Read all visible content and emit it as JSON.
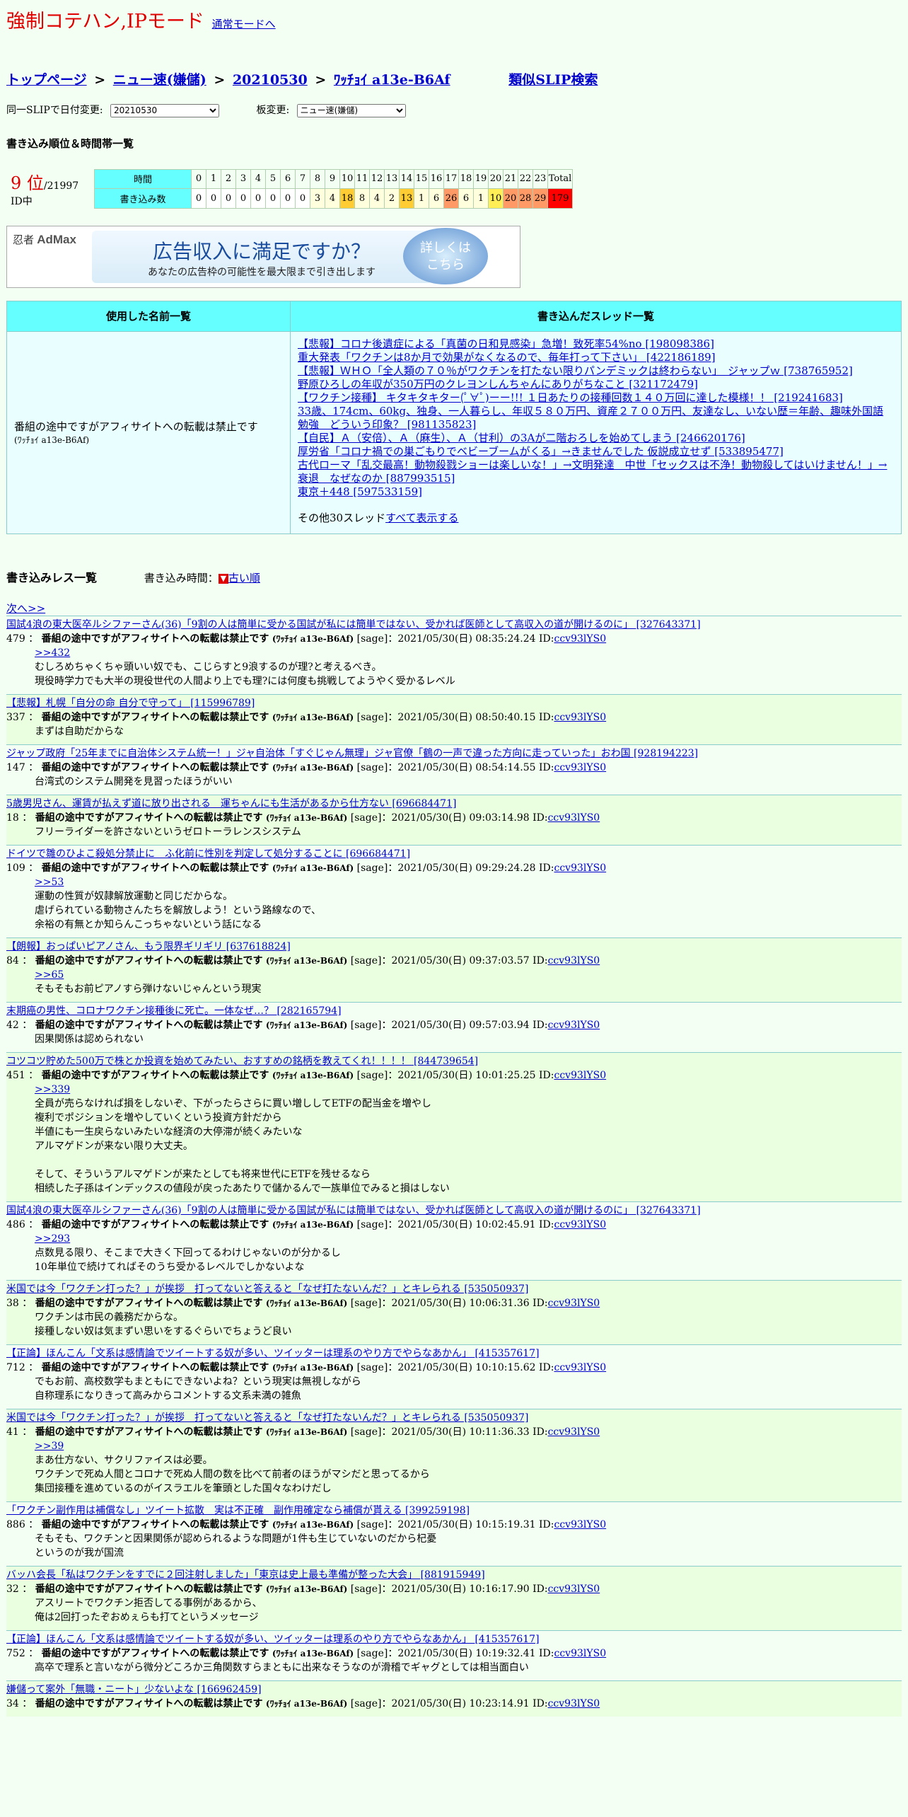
{
  "header": {
    "title": "強制コテハン,IPモード",
    "mode_link": "通常モードへ"
  },
  "breadcrumb": {
    "top": "トップページ",
    "board": "ニュー速(嫌儲)",
    "date": "20210530",
    "slip": "ﾜｯﾁｮｲ a13e-B6Af",
    "similar": "類似SLIP検索",
    "sep": ">"
  },
  "selectors": {
    "date_label": "同一SLIPで日付変更:",
    "date_value": "20210530",
    "board_label": "板変更:",
    "board_value": "ニュー速(嫌儲)"
  },
  "ranking": {
    "heading": "書き込み順位＆時間帯一覧",
    "rank": "9 位",
    "total_ids": "/21997 ID中",
    "time_label": "時間",
    "count_label": "書き込み数",
    "hours": [
      "0",
      "1",
      "2",
      "3",
      "4",
      "5",
      "6",
      "7",
      "8",
      "9",
      "10",
      "11",
      "12",
      "13",
      "14",
      "15",
      "16",
      "17",
      "18",
      "19",
      "20",
      "21",
      "22",
      "23",
      "Total"
    ],
    "counts": [
      "0",
      "0",
      "0",
      "0",
      "0",
      "0",
      "0",
      "0",
      "3",
      "4",
      "18",
      "8",
      "4",
      "2",
      "13",
      "1",
      "6",
      "26",
      "6",
      "1",
      "10",
      "20",
      "28",
      "29",
      "179"
    ],
    "colors": [
      "#ffffff",
      "#ffffff",
      "#ffffff",
      "#ffffff",
      "#ffffff",
      "#ffffff",
      "#ffffff",
      "#ffffff",
      "#ffffdd",
      "#ffffdd",
      "#ffcc33",
      "#ffffdd",
      "#ffffdd",
      "#ffffdd",
      "#ffcc33",
      "#ffffdd",
      "#ffffdd",
      "#ff9966",
      "#ffffdd",
      "#ffffdd",
      "#ffee55",
      "#ff9966",
      "#ff9966",
      "#ff9966",
      "#ff0000"
    ]
  },
  "ad": {
    "logo_a": "忍者",
    "logo_b": "AdMax",
    "headline": "広告収入に満足ですか？",
    "sub": "あなたの広告枠の可能性を最大限まで引き出します",
    "button_a": "詳しくは",
    "button_b": "こちら"
  },
  "names_table": {
    "col1": "使用した名前一覧",
    "col2": "書き込んだスレッド一覧",
    "name": "番組の途中ですがアフィサイトへの転載は禁止です",
    "name_sub": "(ﾜｯﾁｮｲ a13e-B6Af)",
    "threads": [
      "【悲報】コロナ後遺症による「真菌の日和見感染」急増！致死率54%no [198098386]",
      "重大発表「ワクチンは8か月で効果がなくなるので、毎年打って下さい」 [422186189]",
      "【悲報】ＷＨＯ「全人類の７０％がワクチンを打たない限りパンデミックは終わらない」　ジャップｗ [738765952]",
      "野原ひろしの年収が350万円のクレヨンしんちゃんにありがちなこと [321172479]",
      "【ワクチン接種】 キタキタキター(ﾟ∀ﾟ)ーー!!! １日あたりの接種回数１４０万回に達した模様！！ [219241683]",
      "33歳、174cm、60kg、独身、一人暮らし、年収５８０万円、資産２７００万円、友達なし、いない歴＝年齢、趣味外国語勉強　どういう印象？ [981135823]",
      "【自民】Ａ（安倍）、Ａ（麻生）、Ａ（甘利）の3Aが二階おろしを始めてしまう [246620176]",
      "厚労省「コロナ禍での巣ごもりでベビーブームがくる」→きませんでした 仮説成立せず [533895477]",
      "古代ローマ「乱交最高！動物殺戮ショーは楽しいな！」→文明発達　中世「セックスは不浄！動物殺してはいけません！」→衰退　なぜなのか [887993515]",
      "東京＋448 [597533159]"
    ],
    "more_prefix": "その他30スレッド",
    "more_link": "すべて表示する"
  },
  "posts_header": {
    "heading": "書き込みレス一覧",
    "time_label": "書き込み時間：",
    "order_icon": "▼",
    "order_link": "古い順",
    "next": "次へ>>"
  },
  "poster": {
    "name": "番組の途中ですがアフィサイトへの転載は禁止です",
    "slip": "(ﾜｯﾁｮｲ a13e-B6Af)",
    "sage": "[sage]",
    "id": "ccv93lYS0"
  },
  "posts": [
    {
      "thread": "国試4浪の東大医卒ルシファーさん(36)「9割の人は簡単に受かる国試が私には簡単ではない、受かれば医師として高収入の道が開けるのに」 [327643371]",
      "num": "479",
      "date": "2021/05/30(日) 08:35:24.24",
      "reply": ">>432",
      "lines": [
        "むしろめちゃくちゃ頭いい奴でも、こじらすと9浪するのが理?と考えるべき。",
        "現役時学力でも大半の現役世代の人間より上でも理?には何度も挑戦してようやく受かるレベル"
      ]
    },
    {
      "thread": "【悲報】札幌「自分の命 自分で守って」 [115996789]",
      "num": "337",
      "date": "2021/05/30(日) 08:50:40.15",
      "reply": "",
      "lines": [
        "まずは自助だからな"
      ]
    },
    {
      "thread": "ジャップ政府「25年までに自治体システム統一！」ジャ自治体「すぐじゃん無理」ジャ官僚「鶴の一声で違った方向に走っていった」おわ国 [928194223]",
      "num": "147",
      "date": "2021/05/30(日) 08:54:14.55",
      "reply": "",
      "lines": [
        "台湾式のシステム開発を見習ったほうがいい"
      ]
    },
    {
      "thread": "5歳男児さん、運賃が払えず道に放り出される　運ちゃんにも生活があるから仕方ない [696684471]",
      "num": "18",
      "date": "2021/05/30(日) 09:03:14.98",
      "reply": "",
      "lines": [
        "フリーライダーを許さないというゼロトーラレンスシステム"
      ]
    },
    {
      "thread": "ドイツで雛のひよこ殺処分禁止に　ふ化前に性別を判定して処分することに [696684471]",
      "num": "109",
      "date": "2021/05/30(日) 09:29:24.28",
      "reply": ">>53",
      "lines": [
        "運動の性質が奴隷解放運動と同じだからな。",
        "虐げられている動物さんたちを解放しよう！という路線なので、",
        "余裕の有無とか知らんこっちゃないという話になる"
      ]
    },
    {
      "thread": "【朗報】おっぱいピアノさん、もう限界ギリギリ [637618824]",
      "num": "84",
      "date": "2021/05/30(日) 09:37:03.57",
      "reply": ">>65",
      "lines": [
        "そもそもお前ピアノすら弾けないじゃんという現実"
      ]
    },
    {
      "thread": "末期癌の男性、コロナワクチン接種後に死亡。一体なぜ…？ [282165794]",
      "num": "42",
      "date": "2021/05/30(日) 09:57:03.94",
      "reply": "",
      "lines": [
        "因果関係は認められない"
      ]
    },
    {
      "thread": "コツコツ貯めた500万で株とか投資を始めてみたい、おすすめの銘柄を教えてくれ！！！！ [844739654]",
      "num": "451",
      "date": "2021/05/30(日) 10:01:25.25",
      "reply": ">>339",
      "lines": [
        "全員が売らなければ損をしないぞ、下がったらさらに買い増ししてETFの配当金を増やし",
        "複利でポジションを増やしていくという投資方針だから",
        "半値にも一生戻らないみたいな経済の大停滞が続くみたいな",
        "アルマゲドンが来ない限り大丈夫。",
        "",
        "そして、そういうアルマゲドンが来たとしても将来世代にETFを残せるなら",
        "相続した子孫はインデックスの値段が戻ったあたりで儲かるんで一族単位でみると損はしない"
      ]
    },
    {
      "thread": "国試4浪の東大医卒ルシファーさん(36)「9割の人は簡単に受かる国試が私には簡単ではない、受かれば医師として高収入の道が開けるのに」 [327643371]",
      "num": "486",
      "date": "2021/05/30(日) 10:02:45.91",
      "reply": ">>293",
      "lines": [
        "点数見る限り、そこまで大きく下回ってるわけじゃないのが分かるし",
        "10年単位で続けてればそのうち受かるレベルでしかないよな"
      ]
    },
    {
      "thread": "米国では今「ワクチン打った？」が挨拶　打ってないと答えると「なぜ打たないんだ？」とキレられる [535050937]",
      "num": "38",
      "date": "2021/05/30(日) 10:06:31.36",
      "reply": "",
      "lines": [
        "ワクチンは市民の義務だからな。",
        "接種しない奴は気まずい思いをするぐらいでちょうど良い"
      ]
    },
    {
      "thread": "【正論】ほんこん「文系は感情論でツイートする奴が多い、ツイッターは理系のやり方でやらなあかん」 [415357617]",
      "num": "712",
      "date": "2021/05/30(日) 10:10:15.62",
      "reply": "",
      "lines": [
        "でもお前、高校数学もまともにできないよね？という現実は無視しながら",
        "自称理系になりきって高みからコメントする文系未満の雑魚"
      ]
    },
    {
      "thread": "米国では今「ワクチン打った？」が挨拶　打ってないと答えると「なぜ打たないんだ？」とキレられる [535050937]",
      "num": "41",
      "date": "2021/05/30(日) 10:11:36.33",
      "reply": ">>39",
      "lines": [
        "まあ仕方ない、サクリファイスは必要。",
        "ワクチンで死ぬ人間とコロナで死ぬ人間の数を比べて前者のほうがマシだと思ってるから",
        "集団接種を進めているのがイスラエルを筆頭とした国々なわけだし"
      ]
    },
    {
      "thread": "「ワクチン副作用は補償なし」ツイート拡散　実は不正確　副作用確定なら補償が貰える [399259198]",
      "num": "886",
      "date": "2021/05/30(日) 10:15:19.31",
      "reply": "",
      "lines": [
        "そもそも、ワクチンと因果関係が認められるような問題が1件も生じていないのだから杞憂",
        "というのが我が国流"
      ]
    },
    {
      "thread": "バッハ会長「私はワクチンをすでに２回注射しました」「東京は史上最も準備が整った大会」 [881915949]",
      "num": "32",
      "date": "2021/05/30(日) 10:16:17.90",
      "reply": "",
      "lines": [
        "アスリートでワクチン拒否してる事例があるから、",
        "俺は2回打ったぞおめぇらも打てというメッセージ"
      ]
    },
    {
      "thread": "【正論】ほんこん「文系は感情論でツイートする奴が多い、ツイッターは理系のやり方でやらなあかん」 [415357617]",
      "num": "752",
      "date": "2021/05/30(日) 10:19:32.41",
      "reply": "",
      "lines": [
        "高卒で理系と言いながら微分どころか三角関数すらまともに出来なそうなのが滑稽でギャグとしては相当面白い"
      ]
    },
    {
      "thread": "嫌儲って案外「無職・ニート」少ないよな [166962459]",
      "num": "34",
      "date": "2021/05/30(日) 10:23:14.91",
      "reply": "",
      "lines": []
    }
  ]
}
